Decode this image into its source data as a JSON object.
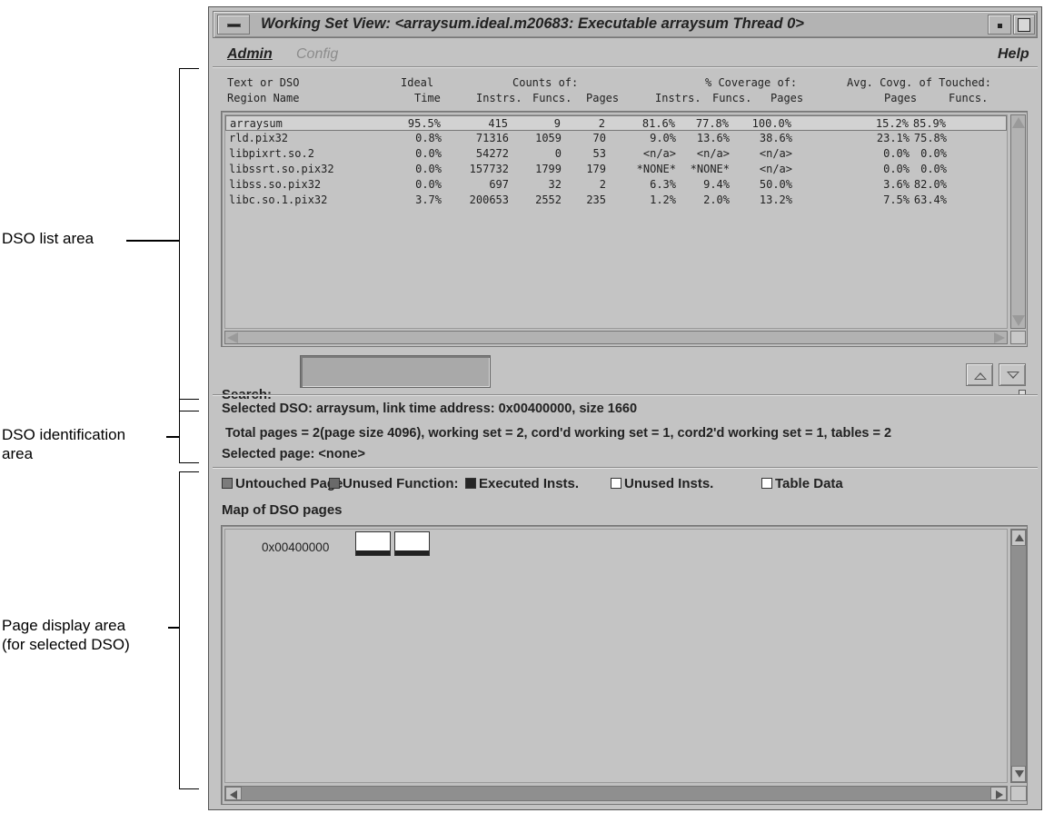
{
  "annotations": {
    "dso_list": "DSO list area",
    "dso_ident_line1": "DSO identification",
    "dso_ident_line2": "area",
    "page_display_line1": "Page display area",
    "page_display_line2": "(for selected DSO)"
  },
  "window": {
    "title": "Working Set View: <arraysum.ideal.m20683: Executable arraysum Thread 0>"
  },
  "menu": {
    "admin": "Admin",
    "config": "Config",
    "help": "Help"
  },
  "headers": {
    "row1": {
      "text_or_dso": "Text or DSO",
      "ideal": "Ideal",
      "counts_of": "Counts of:",
      "coverage_of": "% Coverage of:",
      "avg_covg": "Avg. Covg. of Touched:"
    },
    "row2": {
      "region_name": "Region Name",
      "time": "Time",
      "instrs": "Instrs.",
      "funcs": "Funcs.",
      "pages": "Pages",
      "cov_instrs": "Instrs.",
      "cov_funcs": "Funcs.",
      "cov_pages": "Pages",
      "avg_pages": "Pages",
      "avg_funcs": "Funcs."
    }
  },
  "rows": [
    {
      "name": "arraysum",
      "time": "95.5%",
      "instrs": "415",
      "funcs": "9",
      "pages": "2",
      "cov_instrs": "81.6%",
      "cov_funcs": "77.8%",
      "cov_pages": "100.0%",
      "avg_pages": "15.2%",
      "avg_funcs": "85.9%"
    },
    {
      "name": "rld.pix32",
      "time": "0.8%",
      "instrs": "71316",
      "funcs": "1059",
      "pages": "70",
      "cov_instrs": "9.0%",
      "cov_funcs": "13.6%",
      "cov_pages": "38.6%",
      "avg_pages": "23.1%",
      "avg_funcs": "75.8%"
    },
    {
      "name": "libpixrt.so.2",
      "time": "0.0%",
      "instrs": "54272",
      "funcs": "0",
      "pages": "53",
      "cov_instrs": "<n/a>",
      "cov_funcs": "<n/a>",
      "cov_pages": "<n/a>",
      "avg_pages": "0.0%",
      "avg_funcs": "0.0%"
    },
    {
      "name": "libssrt.so.pix32",
      "time": "0.0%",
      "instrs": "157732",
      "funcs": "1799",
      "pages": "179",
      "cov_instrs": "*NONE*",
      "cov_funcs": "*NONE*",
      "cov_pages": "<n/a>",
      "avg_pages": "0.0%",
      "avg_funcs": "0.0%"
    },
    {
      "name": "libss.so.pix32",
      "time": "0.0%",
      "instrs": "697",
      "funcs": "32",
      "pages": "2",
      "cov_instrs": "6.3%",
      "cov_funcs": "9.4%",
      "cov_pages": "50.0%",
      "avg_pages": "3.6%",
      "avg_funcs": "82.0%"
    },
    {
      "name": "libc.so.1.pix32",
      "time": "3.7%",
      "instrs": "200653",
      "funcs": "2552",
      "pages": "235",
      "cov_instrs": "1.2%",
      "cov_funcs": "2.0%",
      "cov_pages": "13.2%",
      "avg_pages": "7.5%",
      "avg_funcs": "63.4%"
    }
  ],
  "search": {
    "label": "Search:",
    "value": ""
  },
  "info": {
    "selected_dso": "Selected DSO: arraysum, link time address: 0x00400000, size 1660",
    "total_pages": "Total pages = 2(page size 4096), working set = 2, cord'd working set = 1, cord2'd working set = 1, tables = 2",
    "selected_page": "Selected page: <none>"
  },
  "legend": [
    {
      "label": "Untouched Page",
      "color": "#7c7c7c"
    },
    {
      "label": "Unused Function:",
      "color": "#6a6a6a"
    },
    {
      "label": "Executed Insts.",
      "color": "#262626"
    },
    {
      "label": "Unused Insts.",
      "color": "#ffffff"
    },
    {
      "label": "Table Data",
      "color": "#ffffff"
    }
  ],
  "map": {
    "title": "Map of DSO pages",
    "address": "0x00400000",
    "pages": [
      {
        "executed_fraction": 1.0
      },
      {
        "executed_fraction": 1.0
      }
    ]
  }
}
